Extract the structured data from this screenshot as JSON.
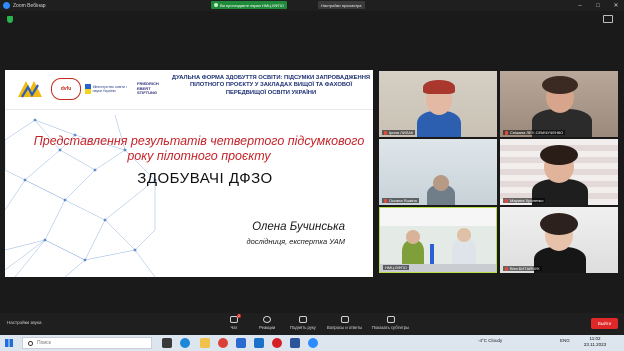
{
  "titlebar": {
    "app_title": "Zoom Вебінар",
    "share_banner": "Ви проглядаєте екран НМЦ ВФПО",
    "view_options": "Настройки просмотра",
    "window_controls": [
      "–",
      "□",
      "✕"
    ]
  },
  "slide": {
    "logos": {
      "dvu": "dvfu",
      "mon": "Міністерство освіти і науки України",
      "fes": "FRIEDRICH EBERT STIFTUNG"
    },
    "header_title": "ДУАЛЬНА ФОРМА ЗДОБУТТЯ ОСВІТИ: ПІДСУМКИ ЗАПРОВАДЖЕННЯ ПІЛОТНОГО ПРОЄКТУ У ЗАКЛАДАХ ВИЩОЇ ТА ФАХОВОЇ ПЕРЕДВИЩОЇ ОСВІТИ УКРАЇНИ",
    "title_line1": "Представлення результатів четвертого підсумкового",
    "title_line2": "року пілотного проєкту",
    "subtitle": "ЗДОБУВАЧІ ДФЗО",
    "presenter_name": "Олена Бучинська",
    "presenter_role": "дослідниця, експертка УАМ"
  },
  "participants": [
    {
      "name": "Ірина ЛИЛАК"
    },
    {
      "name": "Сніжана ЛЕУ-СЕМЧУЧЕНКО"
    },
    {
      "name": "Оксана Яшкіна"
    },
    {
      "name": "Марина Хроленко"
    },
    {
      "name": "НМЦ ВФПО"
    },
    {
      "name": "Віта БИТАЙЧУК"
    }
  ],
  "controls": {
    "sound_settings": "Настройки звука",
    "chat": "Чат",
    "chat_badge": "2",
    "reactions": "Реакции",
    "raise_hand": "Поднять руку",
    "qa": "Вопросы и ответы",
    "captions": "Показать субтитры",
    "leave": "Выйти"
  },
  "taskbar": {
    "search_placeholder": "Поиск",
    "weather": "-4°C  Cloudy",
    "lang": "ENG",
    "time": "11:02",
    "date": "23.11.2023"
  },
  "colors": {
    "accent_red": "#c52228",
    "zoom_blue": "#2d8cff",
    "share_green": "#1f8a3a",
    "leave_red": "#e02828"
  }
}
